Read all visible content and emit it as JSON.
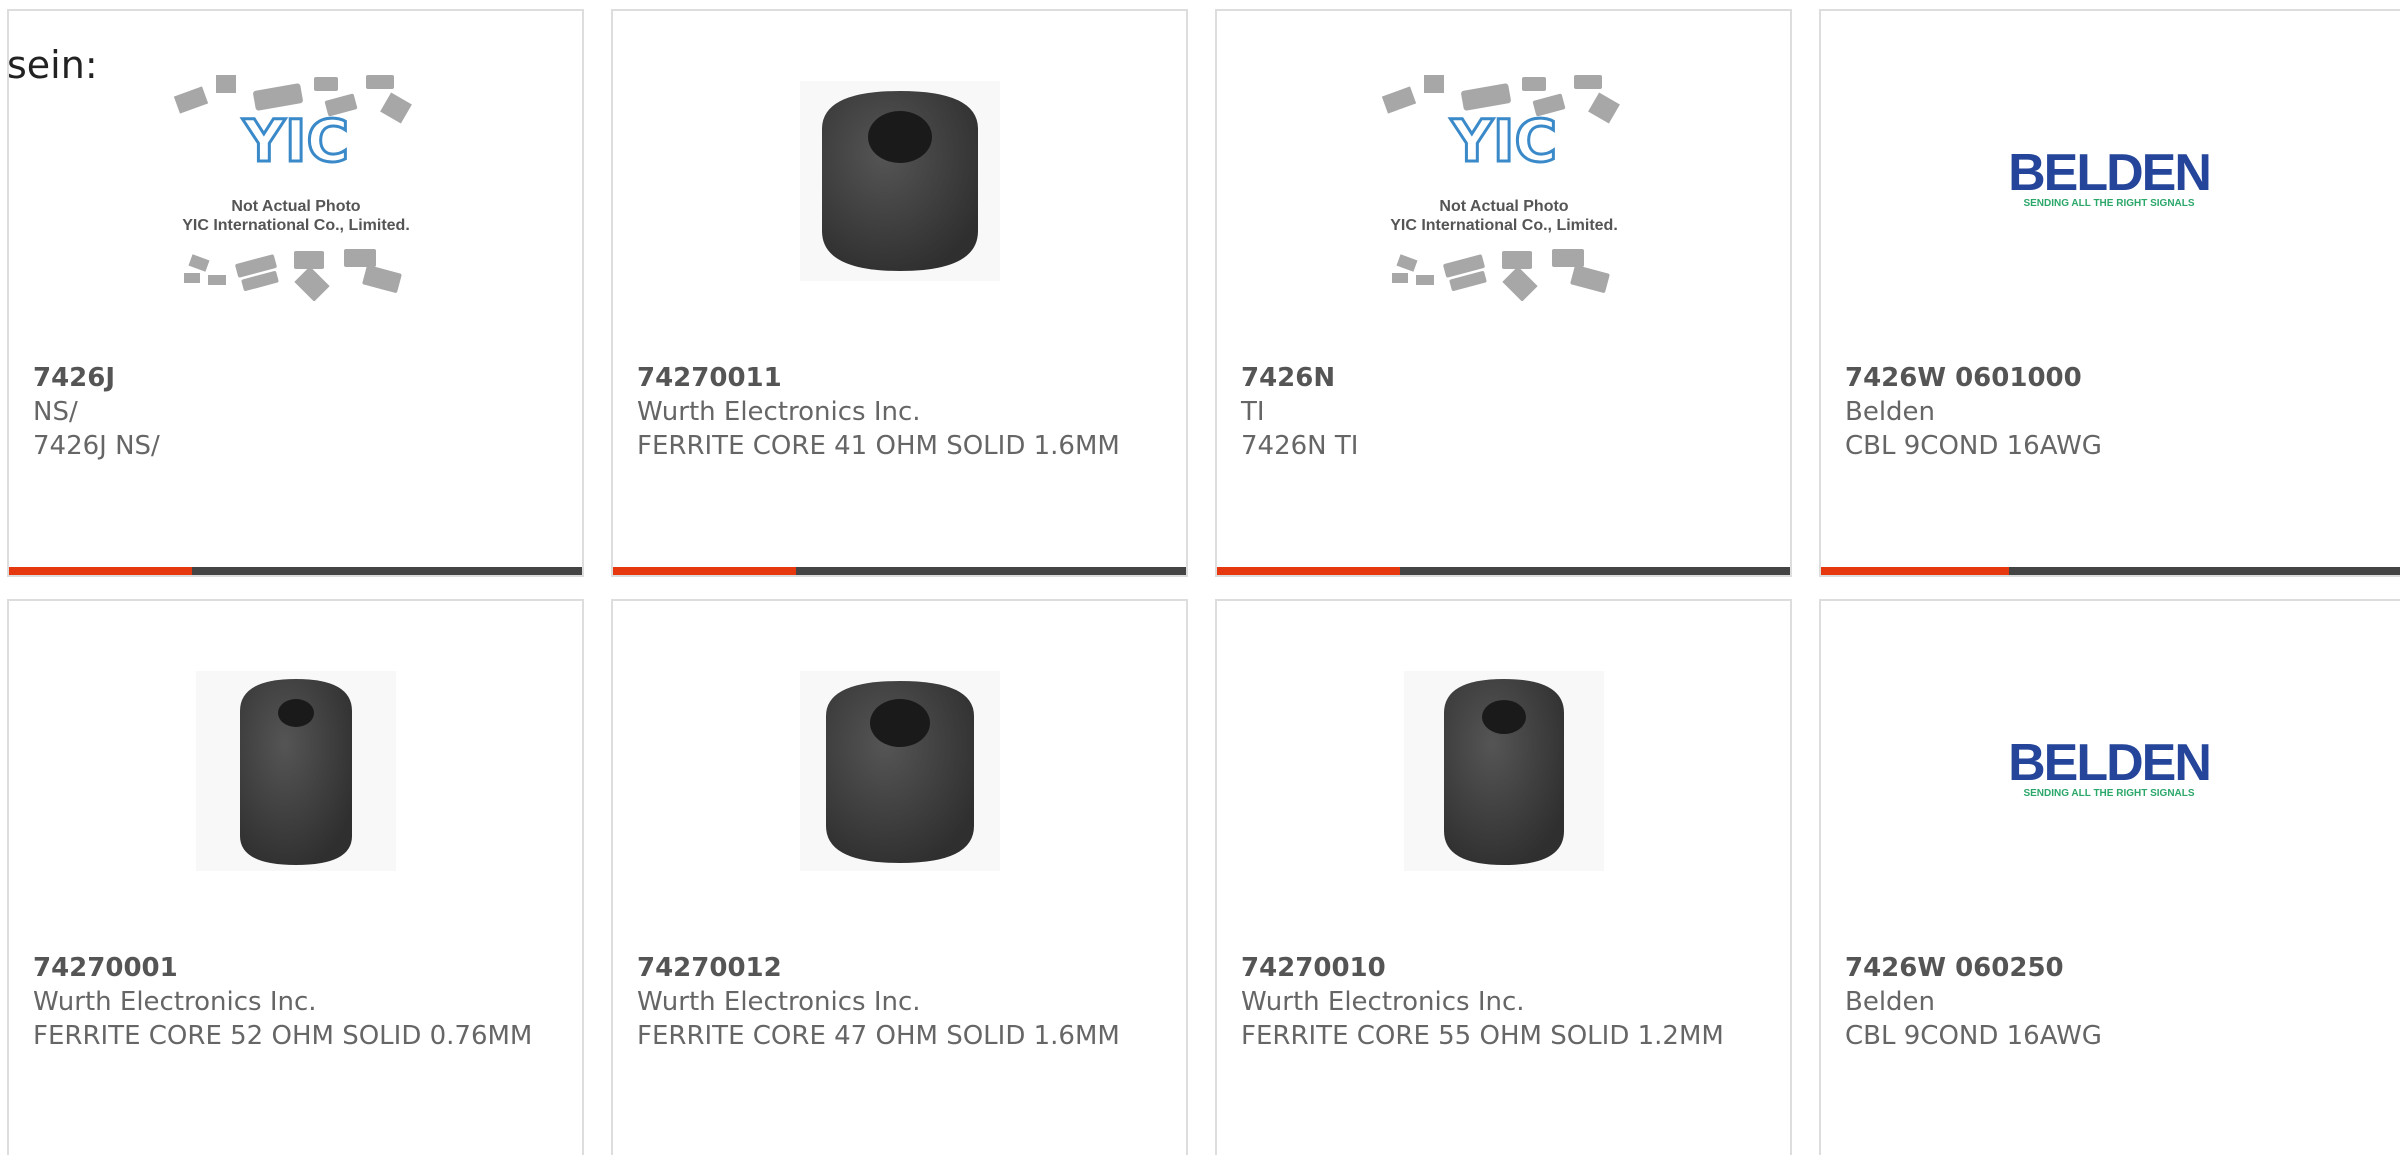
{
  "intro": {
    "text": "sein:"
  },
  "colors": {
    "accent": "#e6380f",
    "bar_track": "#444444",
    "text": "#666666"
  },
  "products": [
    {
      "part_number": "7426J",
      "manufacturer": "NS/",
      "description": "7426J NS/",
      "image": "yic-not-actual-photo",
      "image_caption_line1": "Not Actual Photo",
      "image_caption_line2": "YIC International Co., Limited.",
      "image_logo_text": "YIC",
      "has_bar": true,
      "bar_fill": 0.32
    },
    {
      "part_number": "74270011",
      "manufacturer": "Wurth Electronics Inc.",
      "description": "FERRITE CORE 41 OHM SOLID 1.6MM",
      "image": "ferrite-core-wide",
      "has_bar": true,
      "bar_fill": 0.32
    },
    {
      "part_number": "7426N",
      "manufacturer": "TI",
      "description": "7426N TI",
      "image": "yic-not-actual-photo",
      "image_caption_line1": "Not Actual Photo",
      "image_caption_line2": "YIC International Co., Limited.",
      "image_logo_text": "YIC",
      "has_bar": true,
      "bar_fill": 0.32
    },
    {
      "part_number": "7426W 0601000",
      "manufacturer": "Belden",
      "description": "CBL 9COND 16AWG",
      "image": "belden-logo",
      "image_logo_text": "BELDEN",
      "image_logo_tagline": "SENDING ALL THE RIGHT SIGNALS",
      "has_bar": true,
      "bar_fill": 0.32
    },
    {
      "part_number": "74270001",
      "manufacturer": "Wurth Electronics Inc.",
      "description": "FERRITE CORE 52 OHM SOLID 0.76MM",
      "image": "ferrite-core-narrow",
      "has_bar": false
    },
    {
      "part_number": "74270012",
      "manufacturer": "Wurth Electronics Inc.",
      "description": "FERRITE CORE 47 OHM SOLID 1.6MM",
      "image": "ferrite-core-wide",
      "has_bar": false
    },
    {
      "part_number": "74270010",
      "manufacturer": "Wurth Electronics Inc.",
      "description": "FERRITE CORE 55 OHM SOLID 1.2MM",
      "image": "ferrite-core-medium",
      "has_bar": false
    },
    {
      "part_number": "7426W 060250",
      "manufacturer": "Belden",
      "description": "CBL 9COND 16AWG",
      "image": "belden-logo",
      "image_logo_text": "BELDEN",
      "image_logo_tagline": "SENDING ALL THE RIGHT SIGNALS",
      "has_bar": false
    }
  ]
}
